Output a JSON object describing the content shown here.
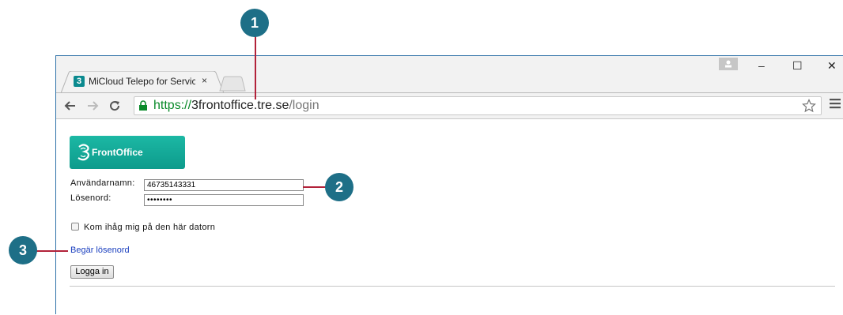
{
  "callouts": [
    "1",
    "2",
    "3"
  ],
  "browser": {
    "tab_favicon": "3",
    "tab_title": "MiCloud Telepo for Servic",
    "tab_close": "×",
    "url_scheme": "https://",
    "url_host": "3frontoffice.tre.se",
    "url_path": "/login"
  },
  "window_controls": {
    "minimize": "–",
    "maximize": "☐",
    "close": "✕"
  },
  "logo": {
    "text": "FrontOffice"
  },
  "form": {
    "username_label": "Användarnamn:",
    "username_value": "46735143331",
    "password_label": "Lösenord:",
    "password_value": "••••••••",
    "remember_label": "Kom ihåg mig på den här datorn",
    "request_password_link": "Begär lösenord",
    "login_button": "Logga in"
  },
  "icons": [
    "back-icon",
    "forward-icon",
    "reload-icon",
    "lock-icon",
    "star-icon",
    "menu-icon",
    "profile-icon"
  ],
  "colors": {
    "callout": "#1e6f87",
    "leader": "#b2223a",
    "window_border": "#2f72a8",
    "logo": "#13a898",
    "link": "#1a3fbf"
  }
}
